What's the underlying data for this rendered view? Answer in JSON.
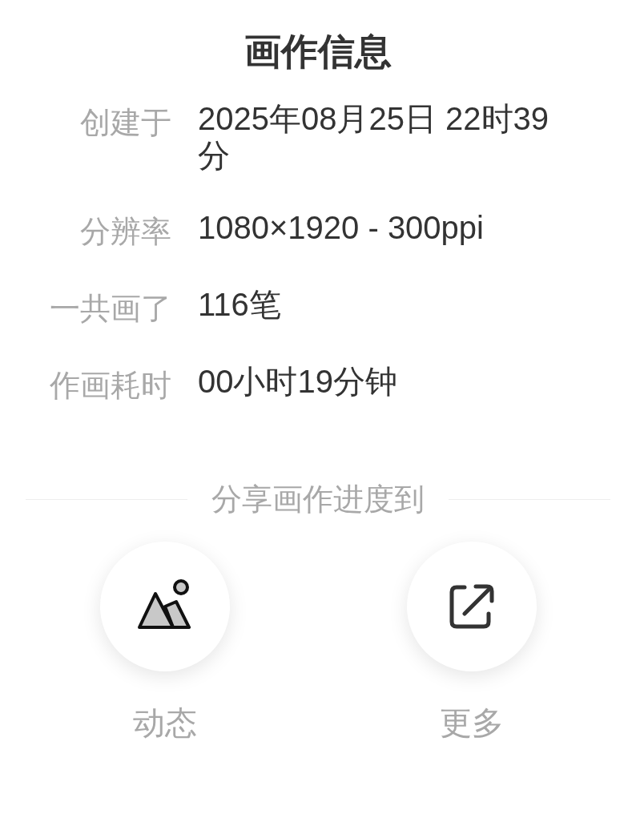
{
  "title": "画作信息",
  "info": [
    {
      "label": "创建于",
      "value": "2025年08月25日 22时39分"
    },
    {
      "label": "分辨率",
      "value": "1080×1920 - 300ppi"
    },
    {
      "label": "一共画了",
      "value": "116笔"
    },
    {
      "label": "作画耗时",
      "value": "00小时19分钟"
    }
  ],
  "share": {
    "heading": "分享画作进度到",
    "targets": [
      {
        "kind": "moments",
        "label": "动态"
      },
      {
        "kind": "more",
        "label": "更多"
      }
    ]
  }
}
